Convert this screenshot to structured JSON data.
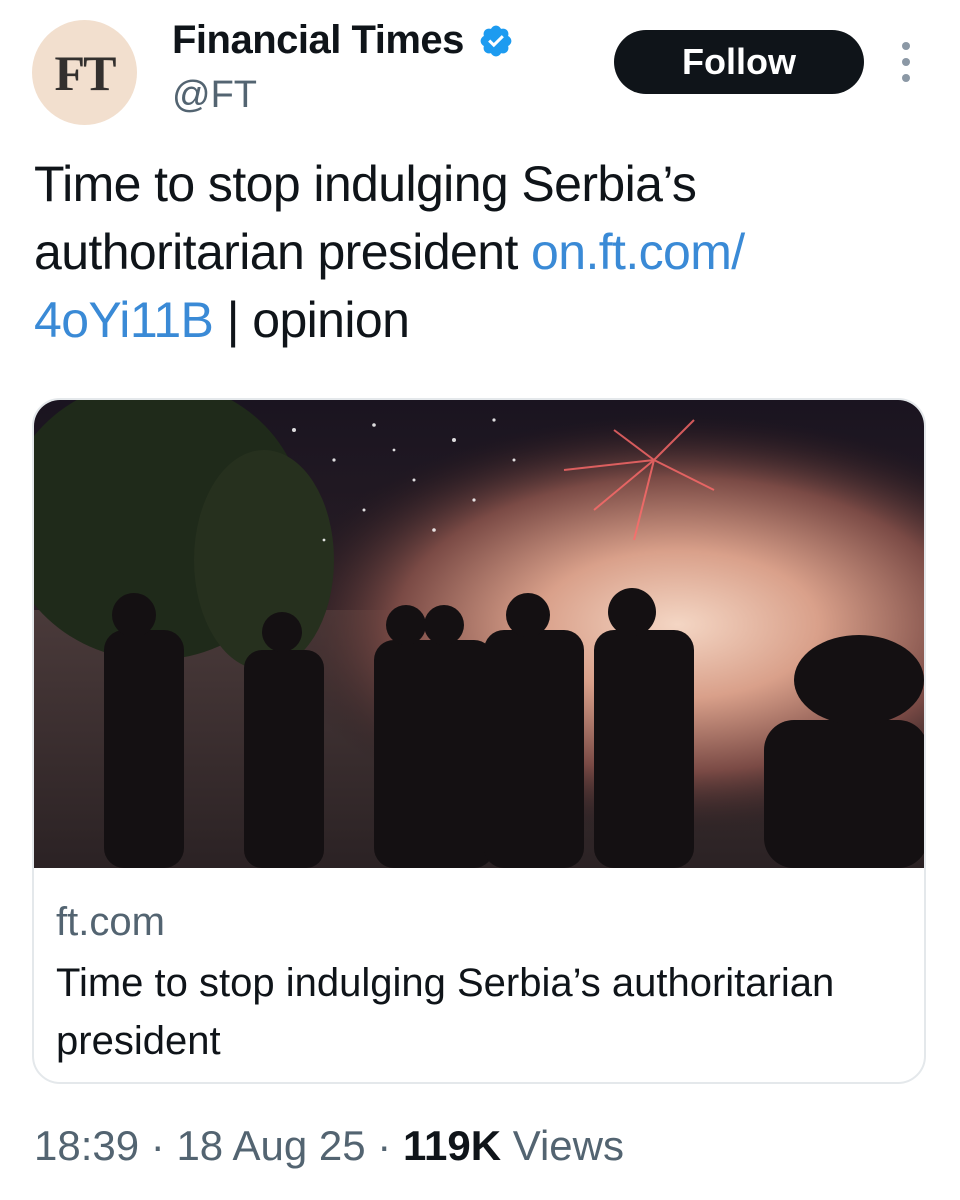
{
  "author": {
    "avatar_text": "FT",
    "name": "Financial Times",
    "handle": "@FT",
    "verified": true
  },
  "follow_label": "Follow",
  "tweet": {
    "text_before": "Time to stop indulging Serbia’s authoritarian president ",
    "link_text": "on.ft.com/​4oYi11B",
    "text_after": " | opinion"
  },
  "card": {
    "image_icon": "riot-police-fireworks-photo",
    "domain": "ft.com",
    "title": "Time to stop indulging Serbia’s authoritarian president"
  },
  "meta": {
    "time": "18:39",
    "separator": " · ",
    "date": "18 Aug 25",
    "views_count": "119K",
    "views_label": " Views"
  },
  "colors": {
    "link": "#3a8ad6",
    "verified": "#1d9bf0",
    "avatar_bg": "#f2dfce",
    "muted": "#536471"
  }
}
